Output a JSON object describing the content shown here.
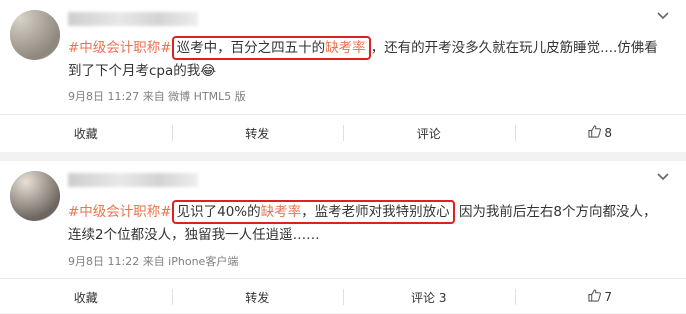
{
  "posts": [
    {
      "topic": "#中级会计职称#",
      "highlight_before": "巡考中，百分之四五十的",
      "highlight_word": "缺考率",
      "text_after": "，还有的开考没多久就在玩儿皮筋睡觉....仿佛看到了下个月考cpa的我😂",
      "meta": "9月8日 11:27 来自 微博 HTML5 版",
      "actions": {
        "favorite": "收藏",
        "repost": "转发",
        "comment": "评论",
        "like": "8"
      }
    },
    {
      "topic": "#中级会计职称#",
      "highlight_before": "见识了40%的",
      "highlight_word": "缺考率",
      "highlight_after": "，监考老师对我特别放心",
      "text_after": "因为我前后左右8个方向都没人，连续2个位都没人，独留我一人任逍遥……",
      "meta": "9月8日 11:22 来自 iPhone客户端",
      "actions": {
        "favorite": "收藏",
        "repost": "转发",
        "comment": "评论 3",
        "like": "7"
      }
    }
  ],
  "icons": {
    "menu": "chevron-down-icon",
    "like": "thumbs-up-icon"
  },
  "colors": {
    "topic": "#eb7350",
    "highlight_box": "#e02020"
  }
}
